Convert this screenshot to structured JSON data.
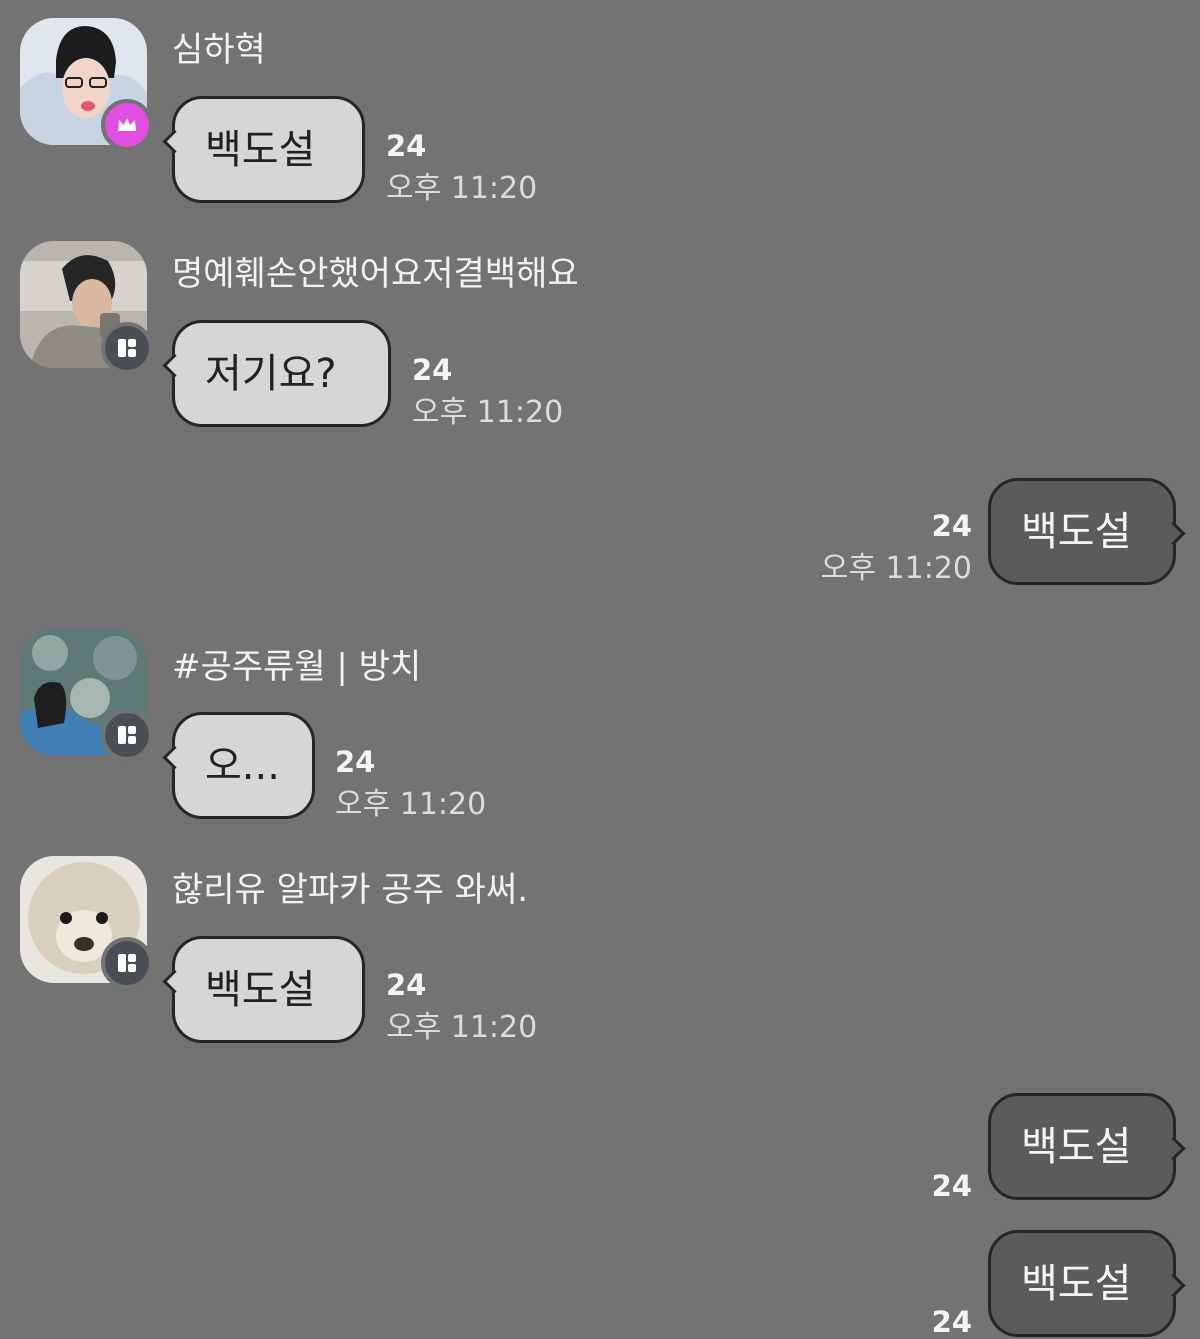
{
  "colors": {
    "background": "#737373",
    "incoming_bubble": "#d6d6d6",
    "outgoing_bubble": "#5b5b5b",
    "host_badge": "#e24fe0",
    "member_badge": "#4a4f57"
  },
  "messages": [
    {
      "sender": "심하혁",
      "badge_icon": "crown-icon",
      "text": "백도설",
      "count": "24",
      "time": "오후 11:20"
    },
    {
      "sender": "명예훼손안했어요저결백해요",
      "badge_icon": "member-icon",
      "text": "저기요?",
      "count": "24",
      "time": "오후 11:20"
    },
    {
      "text": "백도설",
      "count": "24",
      "time": "오후 11:20"
    },
    {
      "sender": "#공주류월 | 방치",
      "badge_icon": "member-icon",
      "text": "오...",
      "count": "24",
      "time": "오후 11:20"
    },
    {
      "sender": "핞리유 알파카 공주 와써.",
      "badge_icon": "member-icon",
      "text": "백도설",
      "count": "24",
      "time": "오후 11:20"
    },
    {
      "text": "백도설",
      "count": "24"
    },
    {
      "text": "백도설",
      "count": "24"
    }
  ]
}
